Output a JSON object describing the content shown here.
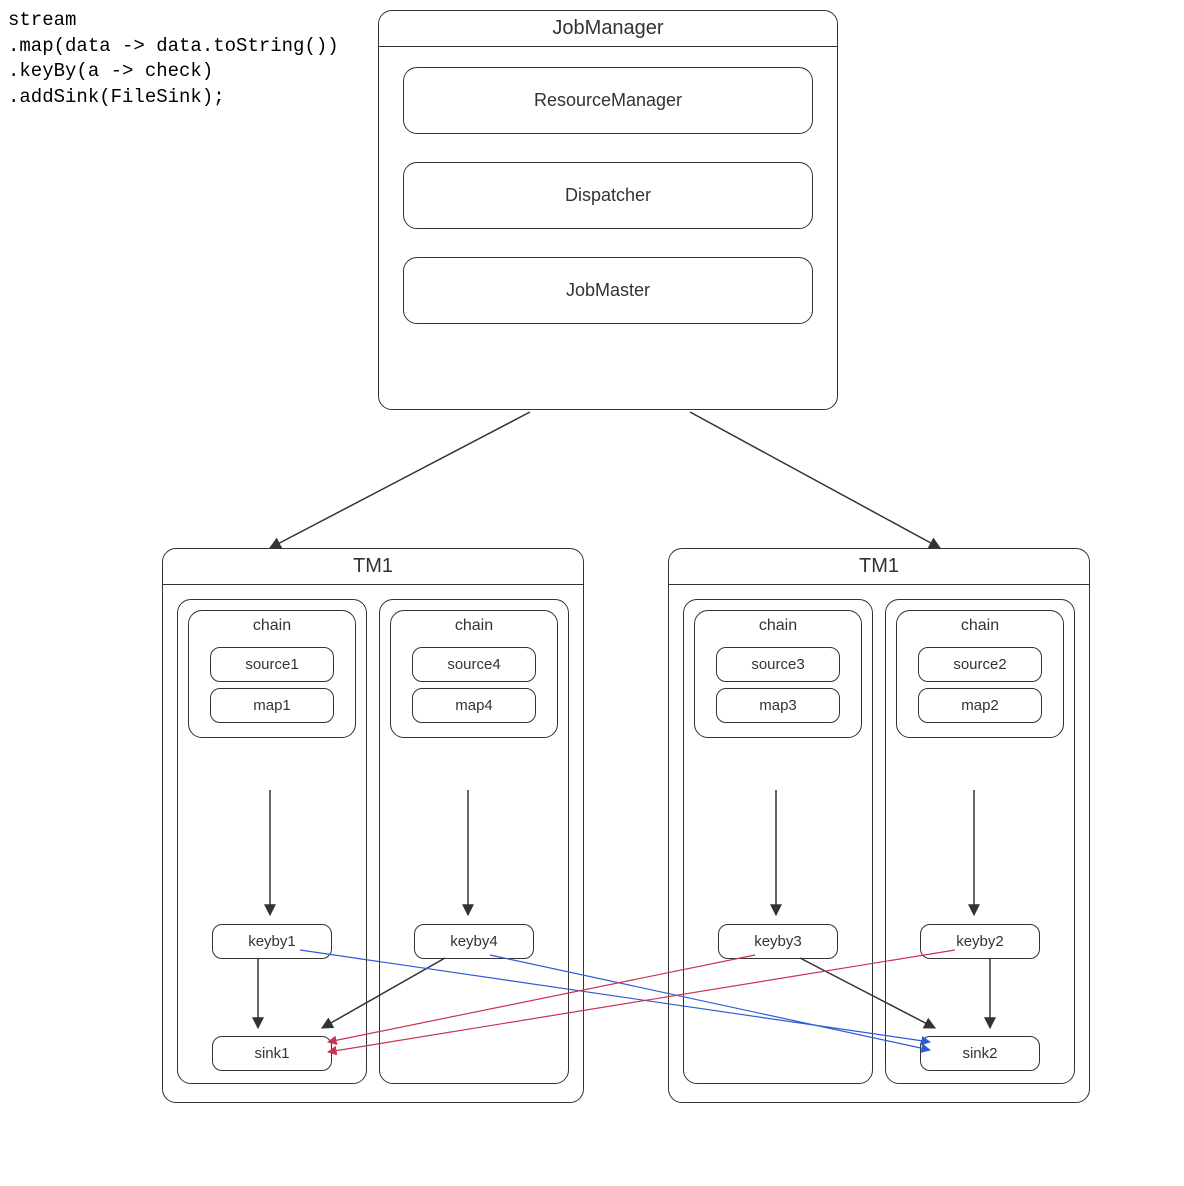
{
  "code": {
    "line1": "stream",
    "line2": ".map(data -> data.toString())",
    "line3": ".keyBy(a -> check)",
    "line4": ".addSink(FileSink);"
  },
  "jobmanager": {
    "title": "JobManager",
    "resource": "ResourceManager",
    "dispatcher": "Dispatcher",
    "jobmaster": "JobMaster"
  },
  "tm": {
    "left": {
      "title": "TM1",
      "slots": [
        {
          "chain": "chain",
          "source": "source1",
          "map": "map1",
          "keyby": "keyby1",
          "sink": "sink1"
        },
        {
          "chain": "chain",
          "source": "source4",
          "map": "map4",
          "keyby": "keyby4",
          "sink": ""
        }
      ]
    },
    "right": {
      "title": "TM1",
      "slots": [
        {
          "chain": "chain",
          "source": "source3",
          "map": "map3",
          "keyby": "keyby3",
          "sink": ""
        },
        {
          "chain": "chain",
          "source": "source2",
          "map": "map2",
          "keyby": "keyby2",
          "sink": "sink2"
        }
      ]
    }
  }
}
